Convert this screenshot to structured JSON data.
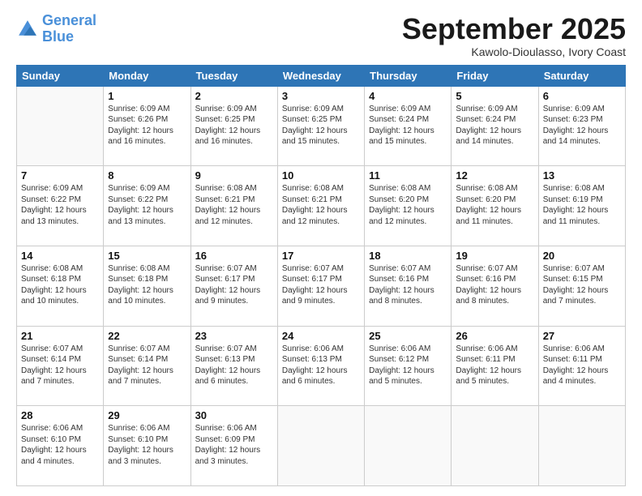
{
  "logo": {
    "line1": "General",
    "line2": "Blue"
  },
  "title": "September 2025",
  "subtitle": "Kawolo-Dioulasso, Ivory Coast",
  "days_of_week": [
    "Sunday",
    "Monday",
    "Tuesday",
    "Wednesday",
    "Thursday",
    "Friday",
    "Saturday"
  ],
  "weeks": [
    [
      {
        "day": "",
        "info": ""
      },
      {
        "day": "1",
        "info": "Sunrise: 6:09 AM\nSunset: 6:26 PM\nDaylight: 12 hours\nand 16 minutes."
      },
      {
        "day": "2",
        "info": "Sunrise: 6:09 AM\nSunset: 6:25 PM\nDaylight: 12 hours\nand 16 minutes."
      },
      {
        "day": "3",
        "info": "Sunrise: 6:09 AM\nSunset: 6:25 PM\nDaylight: 12 hours\nand 15 minutes."
      },
      {
        "day": "4",
        "info": "Sunrise: 6:09 AM\nSunset: 6:24 PM\nDaylight: 12 hours\nand 15 minutes."
      },
      {
        "day": "5",
        "info": "Sunrise: 6:09 AM\nSunset: 6:24 PM\nDaylight: 12 hours\nand 14 minutes."
      },
      {
        "day": "6",
        "info": "Sunrise: 6:09 AM\nSunset: 6:23 PM\nDaylight: 12 hours\nand 14 minutes."
      }
    ],
    [
      {
        "day": "7",
        "info": "Sunrise: 6:09 AM\nSunset: 6:22 PM\nDaylight: 12 hours\nand 13 minutes."
      },
      {
        "day": "8",
        "info": "Sunrise: 6:09 AM\nSunset: 6:22 PM\nDaylight: 12 hours\nand 13 minutes."
      },
      {
        "day": "9",
        "info": "Sunrise: 6:08 AM\nSunset: 6:21 PM\nDaylight: 12 hours\nand 12 minutes."
      },
      {
        "day": "10",
        "info": "Sunrise: 6:08 AM\nSunset: 6:21 PM\nDaylight: 12 hours\nand 12 minutes."
      },
      {
        "day": "11",
        "info": "Sunrise: 6:08 AM\nSunset: 6:20 PM\nDaylight: 12 hours\nand 12 minutes."
      },
      {
        "day": "12",
        "info": "Sunrise: 6:08 AM\nSunset: 6:20 PM\nDaylight: 12 hours\nand 11 minutes."
      },
      {
        "day": "13",
        "info": "Sunrise: 6:08 AM\nSunset: 6:19 PM\nDaylight: 12 hours\nand 11 minutes."
      }
    ],
    [
      {
        "day": "14",
        "info": "Sunrise: 6:08 AM\nSunset: 6:18 PM\nDaylight: 12 hours\nand 10 minutes."
      },
      {
        "day": "15",
        "info": "Sunrise: 6:08 AM\nSunset: 6:18 PM\nDaylight: 12 hours\nand 10 minutes."
      },
      {
        "day": "16",
        "info": "Sunrise: 6:07 AM\nSunset: 6:17 PM\nDaylight: 12 hours\nand 9 minutes."
      },
      {
        "day": "17",
        "info": "Sunrise: 6:07 AM\nSunset: 6:17 PM\nDaylight: 12 hours\nand 9 minutes."
      },
      {
        "day": "18",
        "info": "Sunrise: 6:07 AM\nSunset: 6:16 PM\nDaylight: 12 hours\nand 8 minutes."
      },
      {
        "day": "19",
        "info": "Sunrise: 6:07 AM\nSunset: 6:16 PM\nDaylight: 12 hours\nand 8 minutes."
      },
      {
        "day": "20",
        "info": "Sunrise: 6:07 AM\nSunset: 6:15 PM\nDaylight: 12 hours\nand 7 minutes."
      }
    ],
    [
      {
        "day": "21",
        "info": "Sunrise: 6:07 AM\nSunset: 6:14 PM\nDaylight: 12 hours\nand 7 minutes."
      },
      {
        "day": "22",
        "info": "Sunrise: 6:07 AM\nSunset: 6:14 PM\nDaylight: 12 hours\nand 7 minutes."
      },
      {
        "day": "23",
        "info": "Sunrise: 6:07 AM\nSunset: 6:13 PM\nDaylight: 12 hours\nand 6 minutes."
      },
      {
        "day": "24",
        "info": "Sunrise: 6:06 AM\nSunset: 6:13 PM\nDaylight: 12 hours\nand 6 minutes."
      },
      {
        "day": "25",
        "info": "Sunrise: 6:06 AM\nSunset: 6:12 PM\nDaylight: 12 hours\nand 5 minutes."
      },
      {
        "day": "26",
        "info": "Sunrise: 6:06 AM\nSunset: 6:11 PM\nDaylight: 12 hours\nand 5 minutes."
      },
      {
        "day": "27",
        "info": "Sunrise: 6:06 AM\nSunset: 6:11 PM\nDaylight: 12 hours\nand 4 minutes."
      }
    ],
    [
      {
        "day": "28",
        "info": "Sunrise: 6:06 AM\nSunset: 6:10 PM\nDaylight: 12 hours\nand 4 minutes."
      },
      {
        "day": "29",
        "info": "Sunrise: 6:06 AM\nSunset: 6:10 PM\nDaylight: 12 hours\nand 3 minutes."
      },
      {
        "day": "30",
        "info": "Sunrise: 6:06 AM\nSunset: 6:09 PM\nDaylight: 12 hours\nand 3 minutes."
      },
      {
        "day": "",
        "info": ""
      },
      {
        "day": "",
        "info": ""
      },
      {
        "day": "",
        "info": ""
      },
      {
        "day": "",
        "info": ""
      }
    ]
  ]
}
